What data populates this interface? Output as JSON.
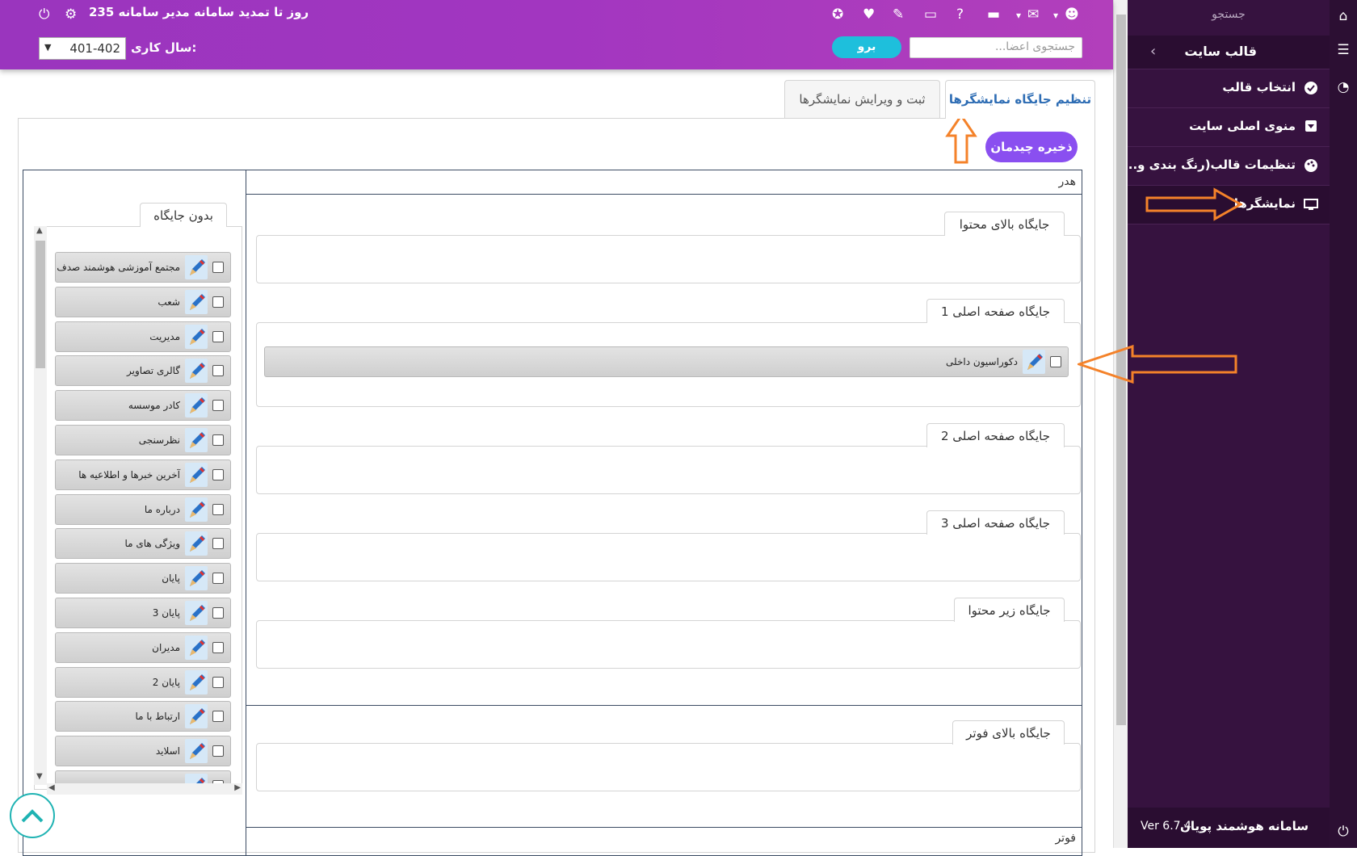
{
  "header": {
    "renew_text": "235 روز تا تمدید سامانه مدیر سامانه",
    "search_placeholder": "جستجوی اعضا...",
    "go_label": "برو",
    "year_label": "سال کاری:",
    "year_value": "401-402"
  },
  "sidebar": {
    "search_label": "جستجو",
    "section_title": "قالب سایت",
    "items": [
      {
        "label": "انتخاب قالب",
        "icon": "check-circle-icon"
      },
      {
        "label": "منوی اصلی سایت",
        "icon": "caret-square-icon"
      },
      {
        "label": "تنظیمات قالب(رنگ بندی و...)",
        "icon": "palette-icon"
      },
      {
        "label": "نمایشگرها",
        "icon": "monitor-icon"
      }
    ],
    "brand": "سامانه هوشمند پویان",
    "version": "Ver 6.7.4"
  },
  "tabs": {
    "active": "تنظیم جایگاه نمایشگرها",
    "edit": "ثبت و ویرایش نمایشگرها"
  },
  "save_label": "ذخیره چیدمان",
  "layout": {
    "header_band": "هدر",
    "footer_band": "فوتر",
    "slots": [
      {
        "title": "جایگاه بالای محتوا",
        "widgets": []
      },
      {
        "title": "جایگاه صفحه اصلی 1",
        "widgets": [
          "دکوراسیون داخلی"
        ]
      },
      {
        "title": "جایگاه صفحه اصلی 2",
        "widgets": []
      },
      {
        "title": "جایگاه صفحه اصلی 3",
        "widgets": []
      },
      {
        "title": "جایگاه زیر محتوا",
        "widgets": []
      },
      {
        "title": "جایگاه بالای فوتر",
        "widgets": []
      }
    ]
  },
  "unassigned": {
    "title": "بدون جایگاه",
    "items": [
      "مجتمع آموزشی هوشمند صدف",
      "شعب",
      "مدیریت",
      "گالری تصاویر",
      "کادر موسسه",
      "نظرسنجی",
      "آخرین خبرها و اطلاعیه ها",
      "درباره ما",
      "ویژگی های ما",
      "پایان",
      "پایان 3",
      "مدیران",
      "پایان 2",
      "ارتباط با ما",
      "اسلاید",
      ""
    ]
  },
  "colors": {
    "header_accent": "#a236c0",
    "sidebar_bg": "#36123f",
    "save_button": "#8a4ff0",
    "go_button": "#1ebfdc",
    "annotation_arrow": "#f4822a"
  }
}
